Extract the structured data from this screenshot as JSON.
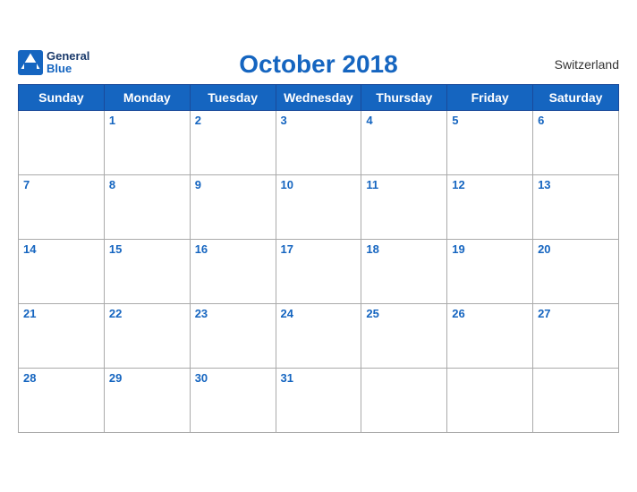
{
  "header": {
    "title": "October 2018",
    "country": "Switzerland",
    "logo_line1": "General",
    "logo_line2": "Blue"
  },
  "weekdays": [
    "Sunday",
    "Monday",
    "Tuesday",
    "Wednesday",
    "Thursday",
    "Friday",
    "Saturday"
  ],
  "weeks": [
    [
      "",
      "1",
      "2",
      "3",
      "4",
      "5",
      "6"
    ],
    [
      "7",
      "8",
      "9",
      "10",
      "11",
      "12",
      "13"
    ],
    [
      "14",
      "15",
      "16",
      "17",
      "18",
      "19",
      "20"
    ],
    [
      "21",
      "22",
      "23",
      "24",
      "25",
      "26",
      "27"
    ],
    [
      "28",
      "29",
      "30",
      "31",
      "",
      "",
      ""
    ]
  ]
}
